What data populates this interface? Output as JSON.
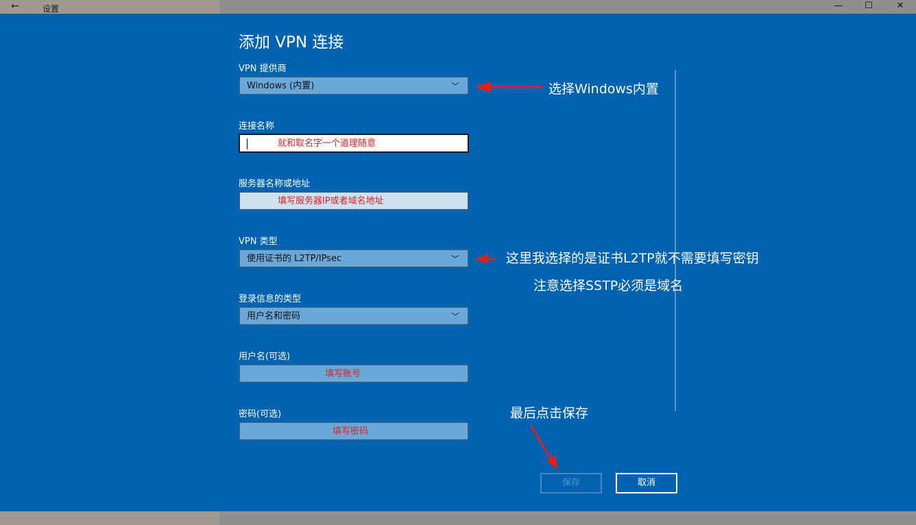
{
  "window": {
    "title": "设置",
    "back_icon": "←",
    "minimize_icon": "—",
    "maximize_icon": "☐",
    "close_icon": "✕"
  },
  "dialog": {
    "heading": "添加 VPN 连接",
    "provider": {
      "label": "VPN 提供商",
      "value": "Windows (内置)"
    },
    "connection_name": {
      "label": "连接名称",
      "value": "就和取名字一个道理随意"
    },
    "server": {
      "label": "服务器名称或地址",
      "value": "填写服务器IP或者域名地址"
    },
    "vpn_type": {
      "label": "VPN 类型",
      "value": "使用证书的 L2TP/IPsec"
    },
    "signin_type": {
      "label": "登录信息的类型",
      "value": "用户名和密码"
    },
    "username": {
      "label": "用户名(可选)",
      "value": "填写账号"
    },
    "password": {
      "label": "密码(可选)",
      "value": "填写密码"
    },
    "save_label": "保存",
    "cancel_label": "取消"
  },
  "annotations": {
    "provider_note": "选择Windows内置",
    "type_note_1": "这里我选择的是证书L2TP就不需要填写密钥",
    "type_note_2": "注意选择SSTP必须是域名",
    "save_note": "最后点击保存"
  },
  "colors": {
    "dialog_bg": "#0063b1",
    "field_bg": "#6aa8d8",
    "annotation_arrow": "#e02020",
    "annotation_text_in_field": "#e02020"
  }
}
